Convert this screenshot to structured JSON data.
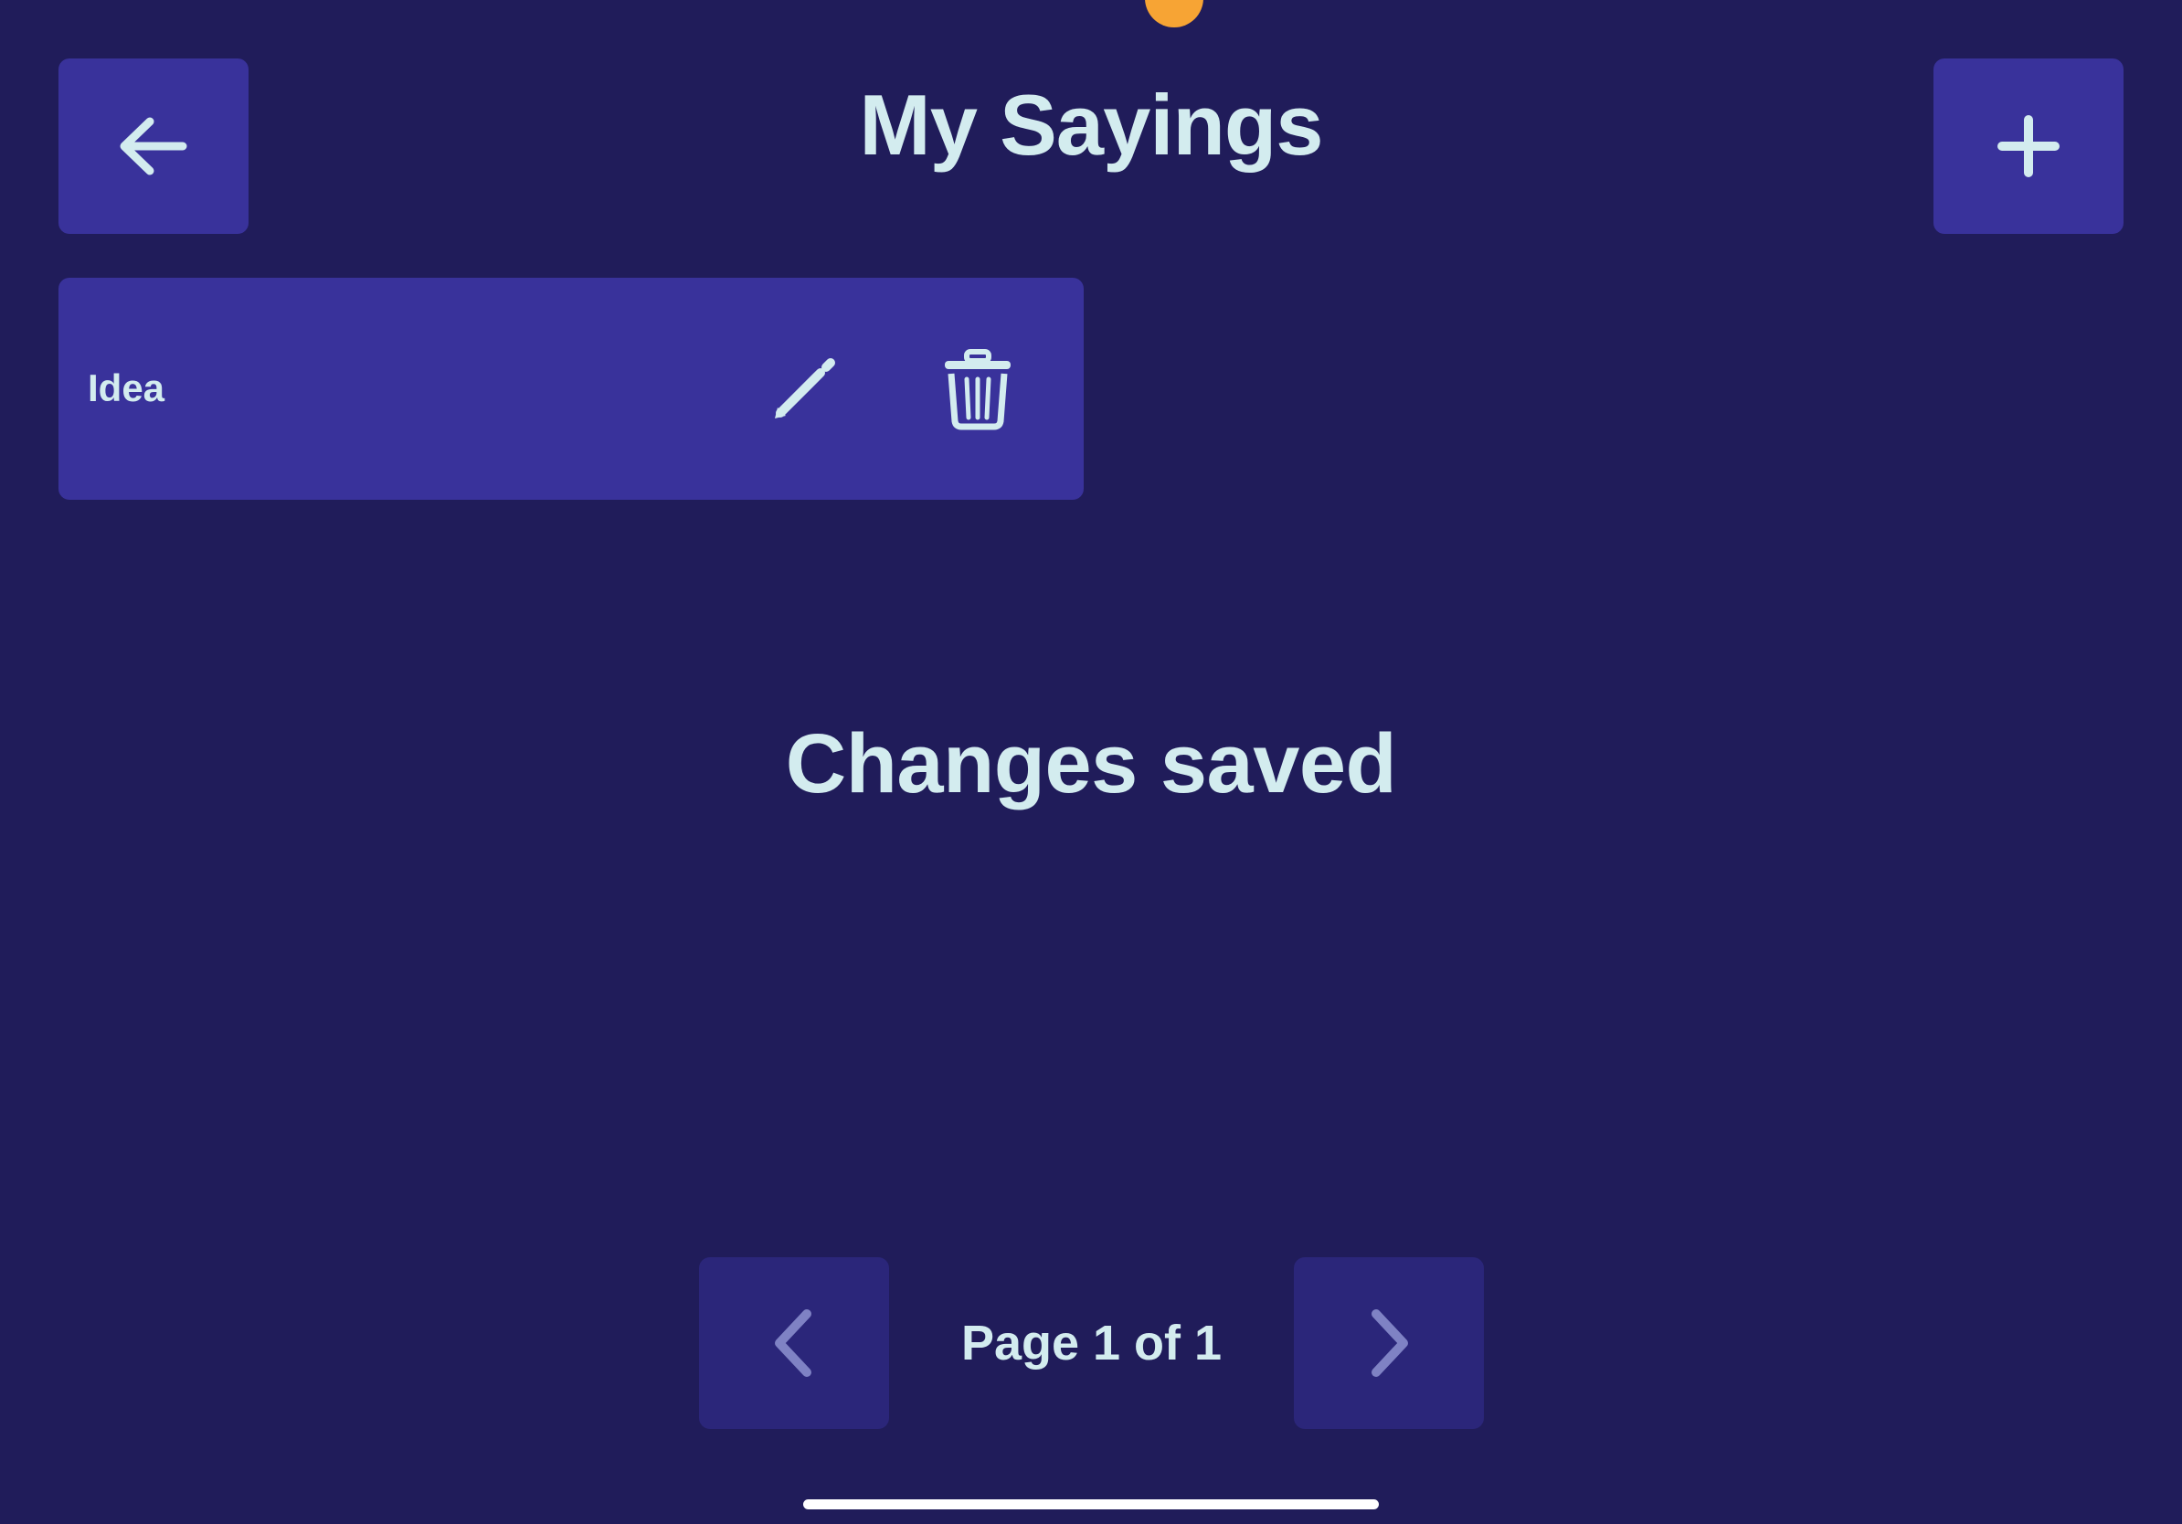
{
  "colors": {
    "background": "#201c5a",
    "button": "#39329b",
    "button_disabled": "#2b267a",
    "text": "#d3ecef",
    "icon_disabled": "#7f82c4",
    "status_dot": "#f7a434",
    "home_indicator": "#ffffff"
  },
  "header": {
    "title": "My Sayings",
    "back_icon": "arrow-left-icon",
    "add_icon": "plus-icon"
  },
  "sayings": [
    {
      "title": "Idea",
      "edit_icon": "pencil-icon",
      "delete_icon": "trash-icon"
    }
  ],
  "toast": {
    "message": "Changes saved"
  },
  "pagination": {
    "label": "Page 1 of 1",
    "current_page": 1,
    "total_pages": 1,
    "prev_icon": "chevron-left-icon",
    "next_icon": "chevron-right-icon",
    "prev_enabled": false,
    "next_enabled": false
  }
}
